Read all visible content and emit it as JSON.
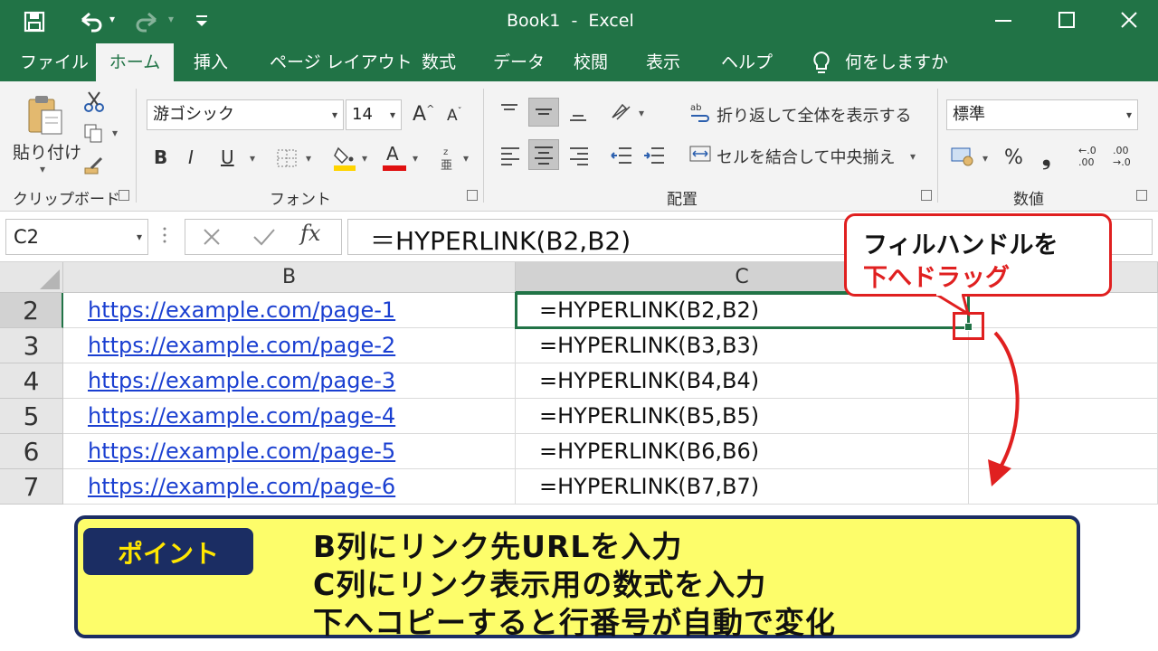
{
  "window": {
    "title": "Book1  -  Excel"
  },
  "tabs": [
    "ファイル",
    "ホーム",
    "挿入",
    "ページ レイアウト",
    "数式",
    "データ",
    "校閲",
    "表示",
    "ヘルプ"
  ],
  "tell_me": "何をしますか",
  "ribbon": {
    "clipboard": {
      "paste_label": "貼り付け",
      "group_label": "クリップボード"
    },
    "font": {
      "font_name": "游ゴシック",
      "font_size": "14",
      "bold": "B",
      "italic": "I",
      "underline": "U",
      "grow": "A",
      "shrink": "A",
      "color_letter": "A",
      "group_label": "フォント"
    },
    "alignment": {
      "wrap_text": "折り返して全体を表示する",
      "merge_center": "セルを結合して中央揃え",
      "group_label": "配置"
    },
    "number": {
      "format": "標準",
      "percent": "%",
      "comma": "❟",
      "inc_top": "←.0",
      "inc_bottom": ".00",
      "dec_top": ".00",
      "dec_bottom": "→.0",
      "group_label": "数値"
    },
    "colors": {
      "fill": "#ffd400",
      "font_color": "#e01010"
    }
  },
  "formula_bar": {
    "name_box": "C2",
    "fx": "fx",
    "formula": "＝HYPERLINK(B2,B2)"
  },
  "sheet": {
    "columns": [
      "B",
      "C"
    ],
    "rows": [
      {
        "row": "2",
        "b": "https://example.com/page-1",
        "c": "=HYPERLINK(B2,B2)"
      },
      {
        "row": "3",
        "b": "https://example.com/page-2",
        "c": "=HYPERLINK(B3,B3)"
      },
      {
        "row": "4",
        "b": "https://example.com/page-3",
        "c": "=HYPERLINK(B4,B4)"
      },
      {
        "row": "5",
        "b": "https://example.com/page-4",
        "c": "=HYPERLINK(B5,B5)"
      },
      {
        "row": "6",
        "b": "https://example.com/page-5",
        "c": "=HYPERLINK(B6,B6)"
      },
      {
        "row": "7",
        "b": "https://example.com/page-6",
        "c": "=HYPERLINK(B7,B7)"
      }
    ]
  },
  "callout": {
    "line1": "フィルハンドルを",
    "line2": "下へドラッグ"
  },
  "note": {
    "badge": "ポイント",
    "lines": [
      "B列にリンク先URLを入力",
      "C列にリンク表示用の数式を入力",
      "下へコピーすると行番号が自動で変化"
    ]
  },
  "theme": {
    "excel_green": "#217346",
    "link_blue": "#1a3fd1",
    "accent_red": "#e02020",
    "note_yellow": "#fdfd6a",
    "note_navy": "#1b2d63"
  }
}
